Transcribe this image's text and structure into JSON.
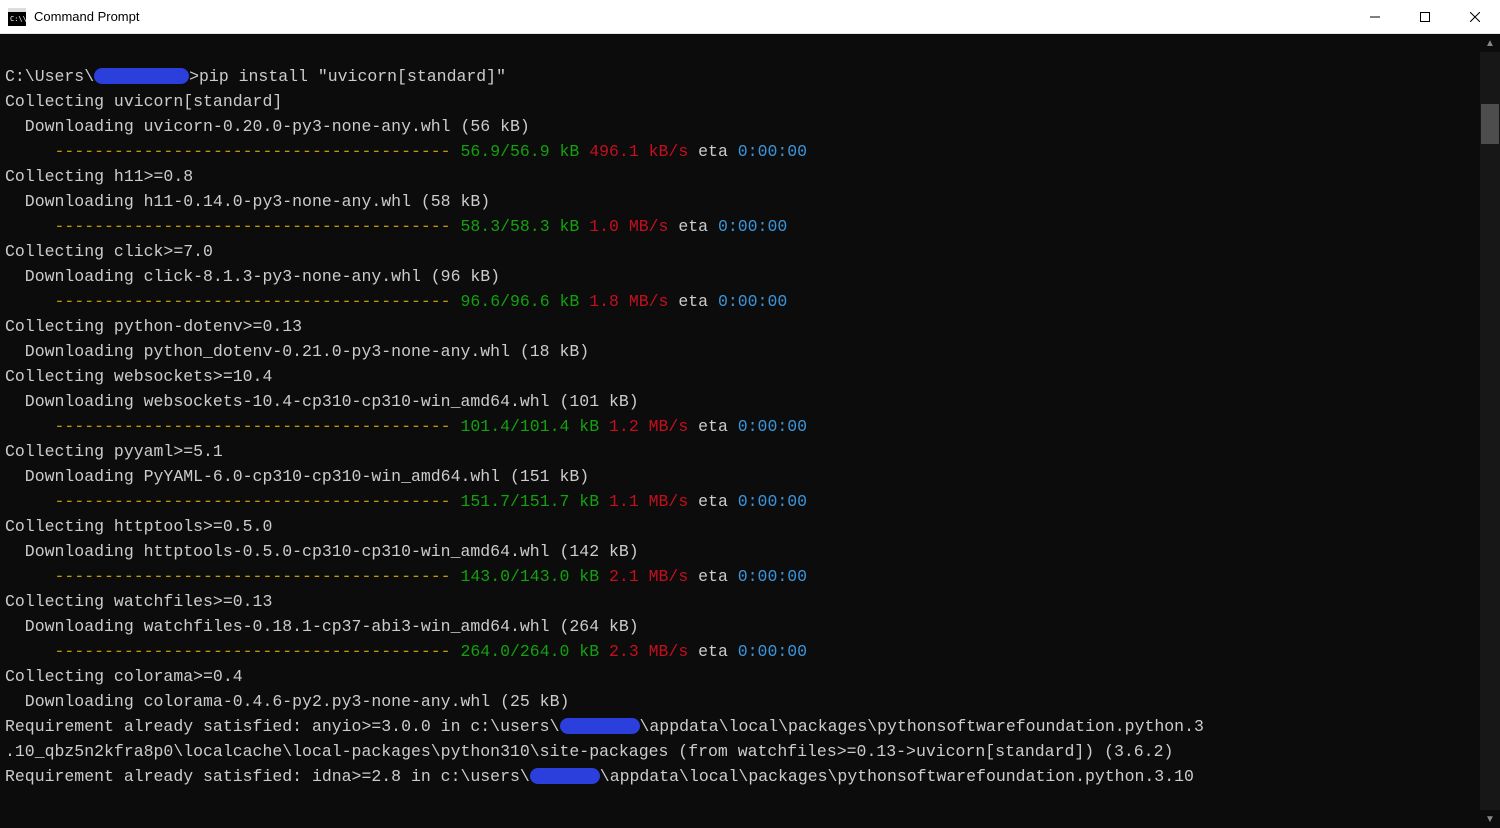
{
  "window": {
    "title": "Command Prompt"
  },
  "prompt": {
    "prefix": "C:\\Users\\",
    "suffix": ">",
    "command": "pip install \"uvicorn[standard]\""
  },
  "dashline": "---------------------------------------- ",
  "packages": [
    {
      "name": "uvicorn[standard]",
      "wheel": "uvicorn-0.20.0-py3-none-any.whl",
      "approx": "56 kB",
      "size": "56.9/56.9 kB",
      "rate": "496.1 kB/s",
      "eta": "0:00:00"
    },
    {
      "name": "h11>=0.8",
      "wheel": "h11-0.14.0-py3-none-any.whl",
      "approx": "58 kB",
      "size": "58.3/58.3 kB",
      "rate": "1.0 MB/s",
      "eta": "0:00:00"
    },
    {
      "name": "click>=7.0",
      "wheel": "click-8.1.3-py3-none-any.whl",
      "approx": "96 kB",
      "size": "96.6/96.6 kB",
      "rate": "1.8 MB/s",
      "eta": "0:00:00"
    },
    {
      "name": "python-dotenv>=0.13",
      "wheel": "python_dotenv-0.21.0-py3-none-any.whl",
      "approx": "18 kB",
      "noprogress": true
    },
    {
      "name": "websockets>=10.4",
      "wheel": "websockets-10.4-cp310-cp310-win_amd64.whl",
      "approx": "101 kB",
      "size": "101.4/101.4 kB",
      "rate": "1.2 MB/s",
      "eta": "0:00:00"
    },
    {
      "name": "pyyaml>=5.1",
      "wheel": "PyYAML-6.0-cp310-cp310-win_amd64.whl",
      "approx": "151 kB",
      "size": "151.7/151.7 kB",
      "rate": "1.1 MB/s",
      "eta": "0:00:00"
    },
    {
      "name": "httptools>=0.5.0",
      "wheel": "httptools-0.5.0-cp310-cp310-win_amd64.whl",
      "approx": "142 kB",
      "size": "143.0/143.0 kB",
      "rate": "2.1 MB/s",
      "eta": "0:00:00"
    },
    {
      "name": "watchfiles>=0.13",
      "wheel": "watchfiles-0.18.1-cp37-abi3-win_amd64.whl",
      "approx": "264 kB",
      "size": "264.0/264.0 kB",
      "rate": "2.3 MB/s",
      "eta": "0:00:00"
    },
    {
      "name": "colorama>=0.4",
      "wheel": "colorama-0.4.6-py2.py3-none-any.whl",
      "approx": "25 kB",
      "noprogress": true
    }
  ],
  "labels": {
    "collecting": "Collecting ",
    "downloading": "  Downloading ",
    "eta": " eta ",
    "req_satisfied": "Requirement already satisfied: "
  },
  "req1": {
    "part1": "anyio>=3.0.0 in c:\\users\\",
    "part2": "\\appdata\\local\\packages\\pythonsoftwarefoundation.python.3",
    "part3": ".10_qbz5n2kfra8p0\\localcache\\local-packages\\python310\\site-packages (from watchfiles>=0.13->uvicorn[standard]) (3.6.2)"
  },
  "req2": {
    "part1": "idna>=2.8 in c:\\users\\",
    "part2": "\\appdata\\local\\packages\\pythonsoftwarefoundation.python.3.10"
  }
}
